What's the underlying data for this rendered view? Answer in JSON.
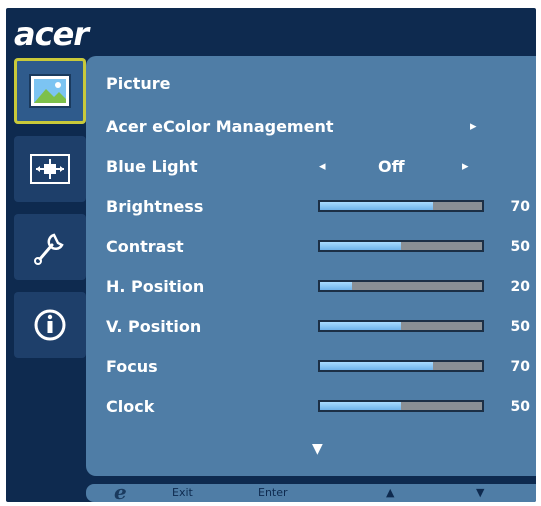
{
  "brand": "acer",
  "sidebar": {
    "items": [
      {
        "icon": "picture-icon",
        "active": true
      },
      {
        "icon": "osd-position-icon",
        "active": false
      },
      {
        "icon": "settings-wrench-icon",
        "active": false
      },
      {
        "icon": "info-icon",
        "active": false
      }
    ]
  },
  "panel": {
    "title": "Picture",
    "rows": [
      {
        "label": "Acer eColor Management",
        "type": "submenu",
        "arrow": "▸"
      },
      {
        "label": "Blue Light",
        "type": "option",
        "left_arrow": "◂",
        "value": "Off",
        "right_arrow": "▸"
      },
      {
        "label": "Brightness",
        "type": "slider",
        "value": 70
      },
      {
        "label": "Contrast",
        "type": "slider",
        "value": 50
      },
      {
        "label": "H. Position",
        "type": "slider",
        "value": 20
      },
      {
        "label": "V. Position",
        "type": "slider",
        "value": 50
      },
      {
        "label": "Focus",
        "type": "slider",
        "value": 70
      },
      {
        "label": "Clock",
        "type": "slider",
        "value": 50
      }
    ],
    "more_arrow": "▼"
  },
  "footer": {
    "e_key": "e",
    "exit_label": "Exit",
    "enter_label": "Enter",
    "up_arrow": "▲",
    "down_arrow": "▼"
  },
  "colors": {
    "background": "#0e2a4f",
    "panel": "#4f7da6",
    "bar_fill": "#8ccbf5",
    "bar_track": "#8a8f94",
    "active_outline": "#c9c93a"
  }
}
